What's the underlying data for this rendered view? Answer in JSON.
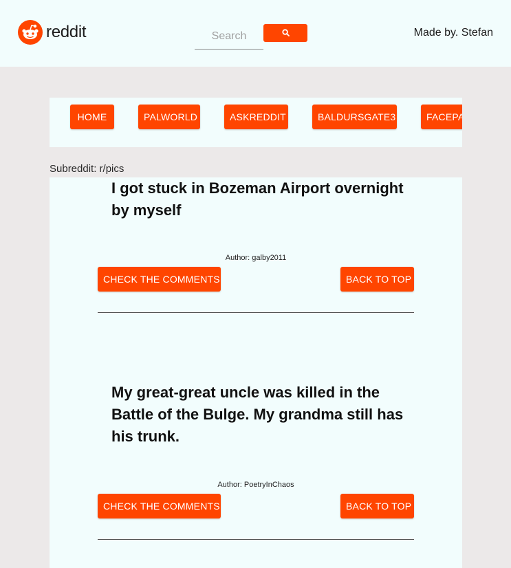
{
  "header": {
    "logo_text": "reddit",
    "search": {
      "placeholder": "Search",
      "value": ""
    },
    "search_button_icon": "search-icon",
    "made_by": "Made by. Stefan"
  },
  "nav": {
    "items": [
      {
        "label": "HOME"
      },
      {
        "label": "PALWORLD"
      },
      {
        "label": "ASKREDDIT"
      },
      {
        "label": "BALDURSGATE3"
      },
      {
        "label": "FACEPALM"
      }
    ]
  },
  "subreddit_label": "Subreddit: r/pics",
  "posts": [
    {
      "title": "I got stuck in Bozeman Airport overnight by myself",
      "author": "Author: galby2011",
      "comments_label": "CHECK THE COMMENTS",
      "back_label": "BACK TO TOP"
    },
    {
      "title": "My great-great uncle was killed in the Battle of the Bulge. My grandma still has his trunk.",
      "author": "Author: PoetryInChaos",
      "comments_label": "CHECK THE COMMENTS",
      "back_label": "BACK TO TOP"
    }
  ],
  "colors": {
    "accent": "#ff4500",
    "header_bg": "#f2fdfd",
    "page_bg": "#ece9e9"
  }
}
